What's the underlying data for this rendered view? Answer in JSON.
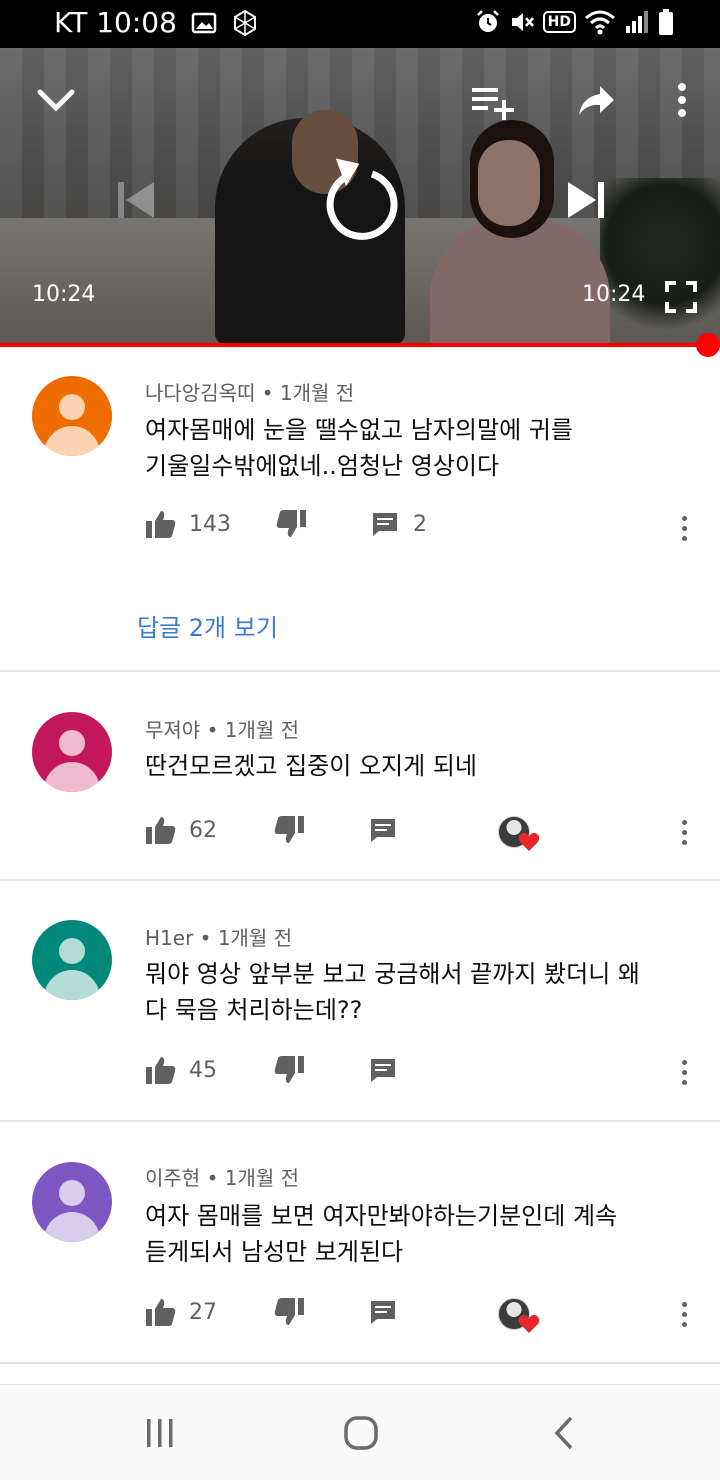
{
  "status_bar": {
    "carrier_time": "KT 10:08",
    "icons": [
      "image-icon",
      "app-icon",
      "alarm-icon",
      "mute-icon",
      "hd-icon",
      "wifi-icon",
      "signal-icon",
      "battery-icon"
    ],
    "hd_label": "HD"
  },
  "player": {
    "current_time": "10:24",
    "duration": "10:24",
    "progress": 1.0,
    "icons": [
      "chevron-down-icon",
      "add-to-playlist-icon",
      "share-icon",
      "more-vert-icon",
      "previous-icon",
      "replay-icon",
      "next-icon",
      "fullscreen-icon"
    ],
    "progress_color": "#ff0000"
  },
  "comments": [
    {
      "author": "나다앙김옥띠",
      "age": "1개월 전",
      "avatar_color": "#ef6c00",
      "text_lines": [
        "여자몸매에 눈을 땔수없고 남자의말에 귀를",
        "기울일수밖에없네..엄청난 영상이다"
      ],
      "likes": "143",
      "replies": "2",
      "hearted": false
    },
    {
      "author": "무져야",
      "age": "1개월 전",
      "avatar_color": "#c2185b",
      "text_lines": [
        "딴건모르겠고 집중이 오지게 되네"
      ],
      "likes": "62",
      "replies": "",
      "hearted": true
    },
    {
      "author": "H1er",
      "age": "1개월 전",
      "avatar_color": "#00897b",
      "text_lines": [
        "뭐야 영상 앞부분 보고 궁금해서 끝까지 봤더니 왜",
        "다 묵음 처리하는데??"
      ],
      "likes": "45",
      "replies": "",
      "hearted": false
    },
    {
      "author": "이주현",
      "age": "1개월 전",
      "avatar_color": "#7e57c2",
      "text_lines": [
        "여자 몸매를 보면 여자만봐야하는기분인데 계속",
        "듣게되서 남성만 보게된다"
      ],
      "likes": "27",
      "replies": "",
      "hearted": true
    }
  ],
  "separator": "•",
  "reply_link": "답글 2개 보기",
  "colors": {
    "link": "#3d7bd1",
    "heart": "#e8262b",
    "meta": "#606060"
  },
  "navbar": {
    "icons": [
      "recent-apps-icon",
      "home-icon",
      "back-icon"
    ]
  }
}
